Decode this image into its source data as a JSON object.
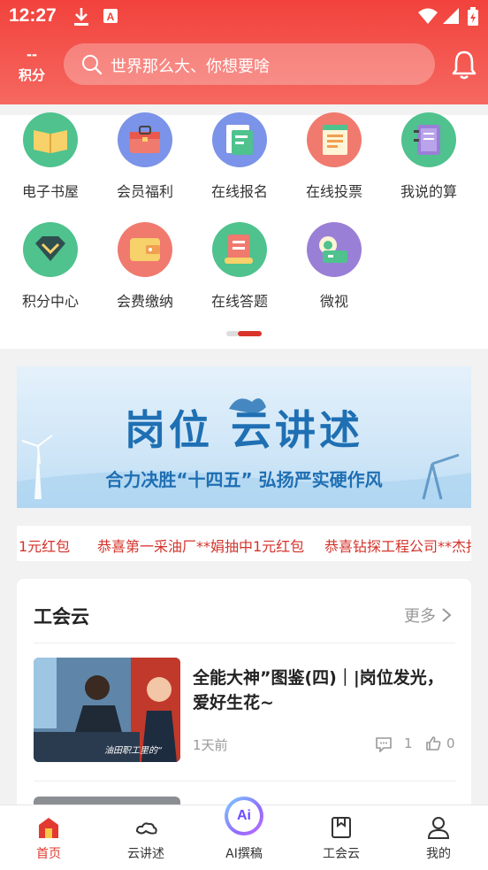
{
  "status_bar": {
    "time": "12:27"
  },
  "header": {
    "points_value": "--",
    "points_label": "积分",
    "search_placeholder": "世界那么大、你想要啥"
  },
  "grid": {
    "items": [
      {
        "label": "电子书屋",
        "icon": "book-icon",
        "color": "#4fc28e"
      },
      {
        "label": "会员福利",
        "icon": "gift-bag-icon",
        "color": "#7b93e8"
      },
      {
        "label": "在线报名",
        "icon": "folder-form-icon",
        "color": "#7b93e8"
      },
      {
        "label": "在线投票",
        "icon": "vote-document-icon",
        "color": "#f07a6e"
      },
      {
        "label": "我说的算",
        "icon": "notebook-icon",
        "color": "#4fc28e"
      },
      {
        "label": "积分中心",
        "icon": "diamond-icon",
        "color": "#4fc28e"
      },
      {
        "label": "会费缴纳",
        "icon": "wallet-icon",
        "color": "#f07a6e"
      },
      {
        "label": "在线答题",
        "icon": "scroll-icon",
        "color": "#4fc28e"
      },
      {
        "label": "微视",
        "icon": "video-camera-icon",
        "color": "#9a7fd6"
      }
    ]
  },
  "banner": {
    "title": "岗位 云讲述",
    "subtitle": "合力决胜“十四五”  弘扬严实硬作风"
  },
  "ticker": {
    "items": [
      "1元红包",
      "恭喜第一采油厂**娟抽中1元红包",
      "恭喜钻探工程公司**杰抽"
    ]
  },
  "card": {
    "title": "工会云",
    "more_label": "更多",
    "news": [
      {
        "title": "全能大神”图鉴(四)｜|岗位发光，爱好生花~",
        "time": "1天前",
        "comments": "1",
        "likes": "0",
        "thumb_caption": "油田职工里的“"
      }
    ]
  },
  "tabbar": {
    "tabs": [
      {
        "label": "首页",
        "icon": "home-icon",
        "active": true
      },
      {
        "label": "云讲述",
        "icon": "cloud-icon",
        "active": false
      },
      {
        "label": "AI撰稿",
        "icon": "ai-icon",
        "active": false,
        "badge_text": "Ai"
      },
      {
        "label": "工会云",
        "icon": "bookmark-icon",
        "active": false
      },
      {
        "label": "我的",
        "icon": "user-icon",
        "active": false
      }
    ]
  },
  "colors": {
    "accent": "#e23a30",
    "header_top": "#f2423c",
    "header_bottom": "#f56860",
    "banner_text": "#1f6fb3"
  }
}
